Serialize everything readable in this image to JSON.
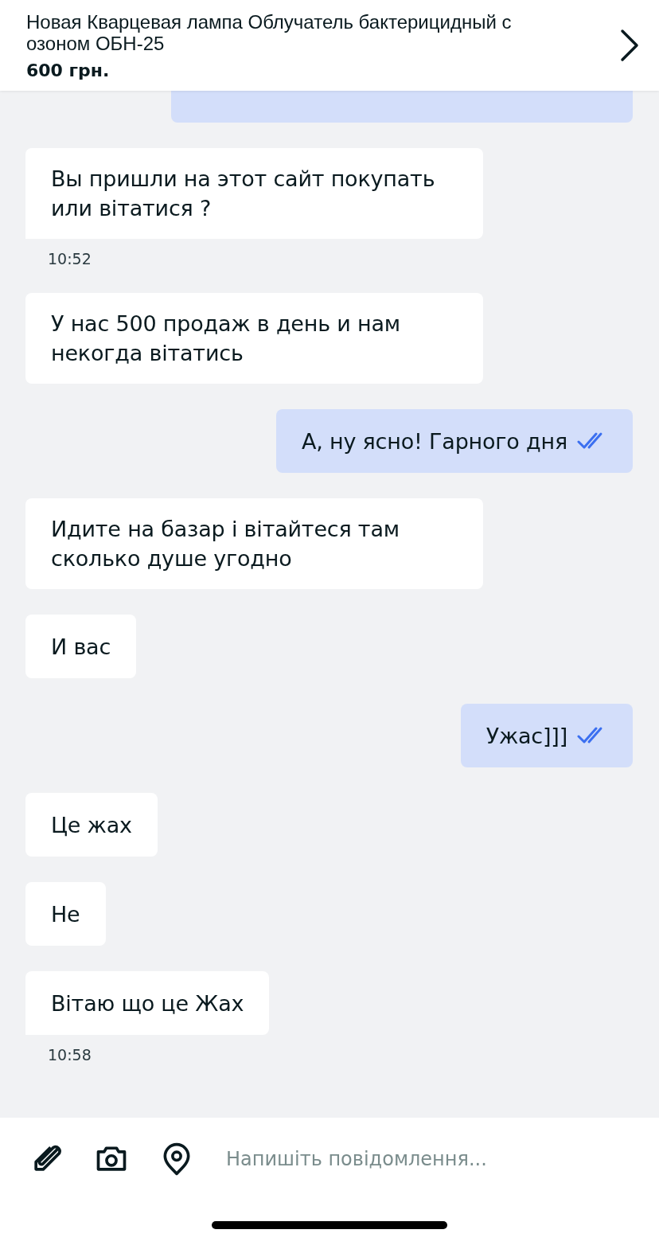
{
  "listing": {
    "title": "Новая Кварцевая лампа Облучатель бактерицидный с озоном ОБН-25",
    "price": "600 грн."
  },
  "messages": [
    {
      "kind": "outgoing"
    },
    {
      "kind": "incoming",
      "text": "Вы пришли на этот сайт покупать или вітатися ?",
      "time": "10:52"
    },
    {
      "kind": "incoming",
      "text": "У нас 500 продаж в день и нам некогда вітатись"
    },
    {
      "kind": "outgoing",
      "text": "А, ну ясно! Гарного дня",
      "read": true
    },
    {
      "kind": "incoming",
      "text": "Идите на базар і вітайтеся там сколько душе угодно"
    },
    {
      "kind": "incoming",
      "text": "И вас"
    },
    {
      "kind": "outgoing",
      "text": "Ужас]]]",
      "read": true
    },
    {
      "kind": "incoming",
      "text": "Це жах"
    },
    {
      "kind": "incoming",
      "text": "Не"
    },
    {
      "kind": "incoming",
      "text": "Вітаю що це Жах",
      "time": "10:58"
    }
  ],
  "composer": {
    "placeholder": "Напишіть повідомлення..."
  }
}
